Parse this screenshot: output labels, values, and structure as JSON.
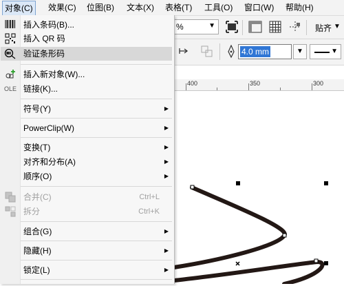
{
  "menubar": [
    {
      "label": "对象(C)"
    },
    {
      "label": "效果(C)"
    },
    {
      "label": "位图(B)"
    },
    {
      "label": "文本(X)"
    },
    {
      "label": "表格(T)"
    },
    {
      "label": "工具(O)"
    },
    {
      "label": "窗口(W)"
    },
    {
      "label": "帮助(H)"
    }
  ],
  "toolbar": {
    "zoom_value": "%",
    "paste_label": "贴齐",
    "outline_width": "4.0 mm"
  },
  "ruler": {
    "labels": [
      "400",
      "350",
      "300"
    ]
  },
  "object_menu": {
    "items": [
      {
        "label": "插入条码(B)...",
        "icon": "barcode-icon"
      },
      {
        "label": "插入 QR 码",
        "icon": "qr-code-icon"
      },
      {
        "label": "验证条形码",
        "icon": "validate-barcode-icon"
      },
      {
        "label": "插入新对象(W)...",
        "icon": "insert-object-icon"
      },
      {
        "label": "链接(K)...",
        "icon": "ole-link-icon"
      },
      {
        "label": "符号(Y)",
        "submenu": true
      },
      {
        "label": "PowerClip(W)",
        "submenu": true
      },
      {
        "label": "变换(T)",
        "submenu": true
      },
      {
        "label": "对齐和分布(A)",
        "submenu": true
      },
      {
        "label": "顺序(O)",
        "submenu": true
      },
      {
        "label": "合并(C)",
        "shortcut": "Ctrl+L",
        "disabled": true,
        "icon": "combine-icon"
      },
      {
        "label": "拆分",
        "shortcut": "Ctrl+K",
        "disabled": true,
        "icon": "break-apart-icon"
      },
      {
        "label": "组合(G)",
        "submenu": true
      },
      {
        "label": "隐藏(H)",
        "submenu": true
      },
      {
        "label": "锁定(L)",
        "submenu": true
      }
    ]
  },
  "colors": {
    "highlight": "#d8d8d8",
    "selection": "#3076d5",
    "curve": "#231815"
  }
}
